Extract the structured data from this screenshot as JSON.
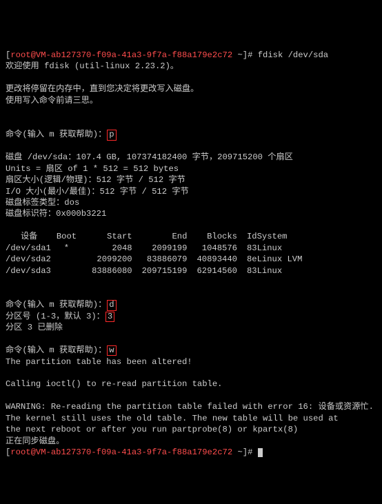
{
  "prompt": {
    "open": "[",
    "user": "root@VM-ab127370-f09a-41a3-9f7a-f88a179e2c72",
    "path": " ~",
    "close": "]# ",
    "cmd": "fdisk /dev/sda"
  },
  "lines": {
    "welcome": "欢迎使用 fdisk (util-linux 2.23.2)。",
    "blank": "",
    "warn1": "更改将停留在内存中，直到您决定将更改写入磁盘。",
    "warn2": "使用写入命令前请三思。",
    "cmdhelp": "命令(输入 m 获取帮助)：",
    "p": "p",
    "disk": "磁盘 /dev/sda：107.4 GB, 107374182400 字节，209715200 个扇区",
    "units": "Units = 扇区 of 1 * 512 = 512 bytes",
    "sector": "扇区大小(逻辑/物理)：512 字节 / 512 字节",
    "io": "I/O 大小(最小/最佳)：512 字节 / 512 字节",
    "label": "磁盘标签类型：dos",
    "ident": "磁盘标识符：0x000b3221",
    "d": "d",
    "partprompt": "分区号 (1-3，默认 3)：",
    "partval": "3",
    "deleted": "分区 3 已删除",
    "w": "w",
    "altered": "The partition table has been altered!",
    "calling": "Calling ioctl() to re-read partition table.",
    "w1": "WARNING: Re-reading the partition table failed with error 16: 设备或资源忙.",
    "w2": "The kernel still uses the old table. The new table will be used at",
    "w3": "the next reboot or after you run partprobe(8) or kpartx(8)",
    "sync": "正在同步磁盘。"
  },
  "table": {
    "headers": [
      "   设备",
      "Boot",
      "Start",
      "End",
      "Blocks",
      "Id",
      "System"
    ],
    "rows": [
      [
        "/dev/sda1",
        "*",
        "2048",
        "2099199",
        "1048576",
        "83",
        "Linux"
      ],
      [
        "/dev/sda2",
        "",
        "2099200",
        "83886079",
        "40893440",
        "8e",
        "Linux LVM"
      ],
      [
        "/dev/sda3",
        "",
        "83886080",
        "209715199",
        "62914560",
        "83",
        "Linux"
      ]
    ]
  }
}
